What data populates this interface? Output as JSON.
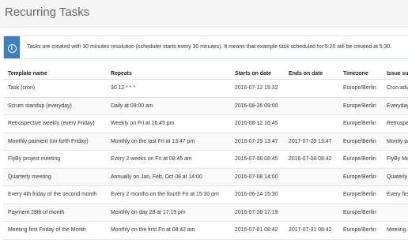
{
  "header": {
    "title": "Recurring Tasks"
  },
  "notice": {
    "icon": "info-icon",
    "icon_glyph": "i",
    "text": "Tasks are created with 30 minutes resolution (scheduler starts every 30 minutes). It means that example task scheduled for 5:20 will be created at 5:30."
  },
  "table": {
    "columns": [
      "Template name",
      "Repeats",
      "Starts on date",
      "Ends on date",
      "Timezone",
      "Issue su"
    ],
    "rows": [
      [
        "Task (cron)",
        "30 12 * * *",
        "2016-07-12 15:32",
        "",
        "Europe/Berlin",
        "Cron adv"
      ],
      [
        "Scrum standup (everyday)",
        "Daily at 09:00 am",
        "2016-08-26 09:00",
        "",
        "Europe/Berlin",
        "Everyday"
      ],
      [
        "Retrospective weekly (every Friday)",
        "Weekly on Fri at 16:45 pm",
        "2016-08-12 16:45",
        "",
        "Europe/Berlin",
        "Retrospe"
      ],
      [
        "Monthly paiment (on forth Friday)",
        "Monthly on the last Fri at 13:47 pm",
        "2016-07-29 13:47",
        "2017-07-29 13:47",
        "Europe/Berlin",
        "Montly pa"
      ],
      [
        "FlyBy project meeting",
        "Every 2 weeks on Fri at 08:45 am",
        "2016-07-08 08:45",
        "2016-07-08 08:42",
        "Europe/Berlin",
        "FlyBy Me"
      ],
      [
        "Quarterly meeting",
        "Annually on Jan, Feb, Oct 08 at 14:00",
        "2016-07-08 14:00",
        "",
        "Europe/Berlin",
        "Quaterly"
      ],
      [
        "Every 4th friday of the second month",
        "Every 2 months on the fourth Fri at 15:30 pm",
        "2016-06-24 15:30",
        "",
        "Europe/Berlin",
        "Every firs"
      ],
      [
        "Payment 28th of month",
        "Monthly on day 28 at 17:19 pm",
        "2016-07-28 17:19",
        "",
        "Europe/Berlin",
        ""
      ],
      [
        "Meeting first Friday of the Month",
        "Monthly on the first Fri at 08:42 am",
        "2016-07-01 08:42",
        "2017-07-31 08:42",
        "Europe/Berlin",
        "Meeting (f"
      ]
    ]
  }
}
